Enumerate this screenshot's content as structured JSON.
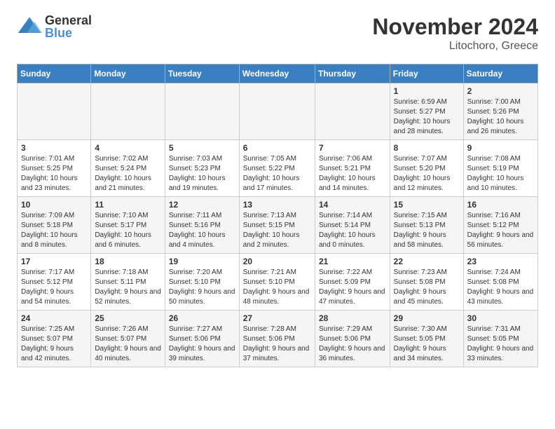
{
  "logo": {
    "general": "General",
    "blue": "Blue"
  },
  "header": {
    "month": "November 2024",
    "location": "Litochoro, Greece"
  },
  "weekdays": [
    "Sunday",
    "Monday",
    "Tuesday",
    "Wednesday",
    "Thursday",
    "Friday",
    "Saturday"
  ],
  "weeks": [
    [
      {
        "day": "",
        "info": ""
      },
      {
        "day": "",
        "info": ""
      },
      {
        "day": "",
        "info": ""
      },
      {
        "day": "",
        "info": ""
      },
      {
        "day": "",
        "info": ""
      },
      {
        "day": "1",
        "info": "Sunrise: 6:59 AM\nSunset: 5:27 PM\nDaylight: 10 hours and 28 minutes."
      },
      {
        "day": "2",
        "info": "Sunrise: 7:00 AM\nSunset: 5:26 PM\nDaylight: 10 hours and 26 minutes."
      }
    ],
    [
      {
        "day": "3",
        "info": "Sunrise: 7:01 AM\nSunset: 5:25 PM\nDaylight: 10 hours and 23 minutes."
      },
      {
        "day": "4",
        "info": "Sunrise: 7:02 AM\nSunset: 5:24 PM\nDaylight: 10 hours and 21 minutes."
      },
      {
        "day": "5",
        "info": "Sunrise: 7:03 AM\nSunset: 5:23 PM\nDaylight: 10 hours and 19 minutes."
      },
      {
        "day": "6",
        "info": "Sunrise: 7:05 AM\nSunset: 5:22 PM\nDaylight: 10 hours and 17 minutes."
      },
      {
        "day": "7",
        "info": "Sunrise: 7:06 AM\nSunset: 5:21 PM\nDaylight: 10 hours and 14 minutes."
      },
      {
        "day": "8",
        "info": "Sunrise: 7:07 AM\nSunset: 5:20 PM\nDaylight: 10 hours and 12 minutes."
      },
      {
        "day": "9",
        "info": "Sunrise: 7:08 AM\nSunset: 5:19 PM\nDaylight: 10 hours and 10 minutes."
      }
    ],
    [
      {
        "day": "10",
        "info": "Sunrise: 7:09 AM\nSunset: 5:18 PM\nDaylight: 10 hours and 8 minutes."
      },
      {
        "day": "11",
        "info": "Sunrise: 7:10 AM\nSunset: 5:17 PM\nDaylight: 10 hours and 6 minutes."
      },
      {
        "day": "12",
        "info": "Sunrise: 7:11 AM\nSunset: 5:16 PM\nDaylight: 10 hours and 4 minutes."
      },
      {
        "day": "13",
        "info": "Sunrise: 7:13 AM\nSunset: 5:15 PM\nDaylight: 10 hours and 2 minutes."
      },
      {
        "day": "14",
        "info": "Sunrise: 7:14 AM\nSunset: 5:14 PM\nDaylight: 10 hours and 0 minutes."
      },
      {
        "day": "15",
        "info": "Sunrise: 7:15 AM\nSunset: 5:13 PM\nDaylight: 9 hours and 58 minutes."
      },
      {
        "day": "16",
        "info": "Sunrise: 7:16 AM\nSunset: 5:12 PM\nDaylight: 9 hours and 56 minutes."
      }
    ],
    [
      {
        "day": "17",
        "info": "Sunrise: 7:17 AM\nSunset: 5:12 PM\nDaylight: 9 hours and 54 minutes."
      },
      {
        "day": "18",
        "info": "Sunrise: 7:18 AM\nSunset: 5:11 PM\nDaylight: 9 hours and 52 minutes."
      },
      {
        "day": "19",
        "info": "Sunrise: 7:20 AM\nSunset: 5:10 PM\nDaylight: 9 hours and 50 minutes."
      },
      {
        "day": "20",
        "info": "Sunrise: 7:21 AM\nSunset: 5:10 PM\nDaylight: 9 hours and 48 minutes."
      },
      {
        "day": "21",
        "info": "Sunrise: 7:22 AM\nSunset: 5:09 PM\nDaylight: 9 hours and 47 minutes."
      },
      {
        "day": "22",
        "info": "Sunrise: 7:23 AM\nSunset: 5:08 PM\nDaylight: 9 hours and 45 minutes."
      },
      {
        "day": "23",
        "info": "Sunrise: 7:24 AM\nSunset: 5:08 PM\nDaylight: 9 hours and 43 minutes."
      }
    ],
    [
      {
        "day": "24",
        "info": "Sunrise: 7:25 AM\nSunset: 5:07 PM\nDaylight: 9 hours and 42 minutes."
      },
      {
        "day": "25",
        "info": "Sunrise: 7:26 AM\nSunset: 5:07 PM\nDaylight: 9 hours and 40 minutes."
      },
      {
        "day": "26",
        "info": "Sunrise: 7:27 AM\nSunset: 5:06 PM\nDaylight: 9 hours and 39 minutes."
      },
      {
        "day": "27",
        "info": "Sunrise: 7:28 AM\nSunset: 5:06 PM\nDaylight: 9 hours and 37 minutes."
      },
      {
        "day": "28",
        "info": "Sunrise: 7:29 AM\nSunset: 5:06 PM\nDaylight: 9 hours and 36 minutes."
      },
      {
        "day": "29",
        "info": "Sunrise: 7:30 AM\nSunset: 5:05 PM\nDaylight: 9 hours and 34 minutes."
      },
      {
        "day": "30",
        "info": "Sunrise: 7:31 AM\nSunset: 5:05 PM\nDaylight: 9 hours and 33 minutes."
      }
    ]
  ]
}
